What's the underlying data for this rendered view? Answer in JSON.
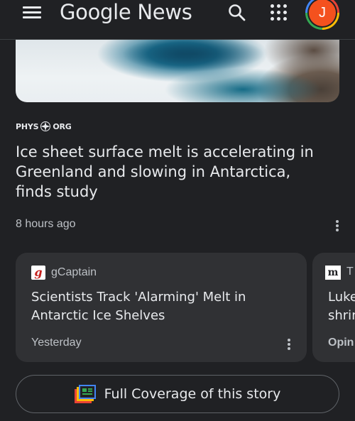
{
  "header": {
    "title": "Google News",
    "avatar_letter": "J",
    "icons": [
      "menu-icon",
      "search-icon",
      "apps-grid-icon",
      "account-avatar"
    ]
  },
  "article": {
    "publisher_left": "PHYS",
    "publisher_right": "ORG",
    "headline": "Ice sheet surface melt is accelerating in Greenland and slowing in Antarctica, finds study",
    "time": "8 hours ago"
  },
  "cards": [
    {
      "source": "gCaptain",
      "source_icon_letter": "g",
      "title": "Scientists Track 'Alarming' Melt in Antarctic Ice Shelves",
      "time": "Yesterday"
    },
    {
      "source_icon_letter": "m",
      "source": "T",
      "title_line1": "Luke",
      "title_line2": "shrin",
      "footer": "Opin"
    }
  ],
  "full_coverage": {
    "label": "Full Coverage of this story"
  },
  "colors": {
    "background": "#202124",
    "card": "#303134",
    "text_primary": "#e8eaed",
    "text_secondary": "#bdc1c6",
    "avatar": "#f4511e"
  }
}
